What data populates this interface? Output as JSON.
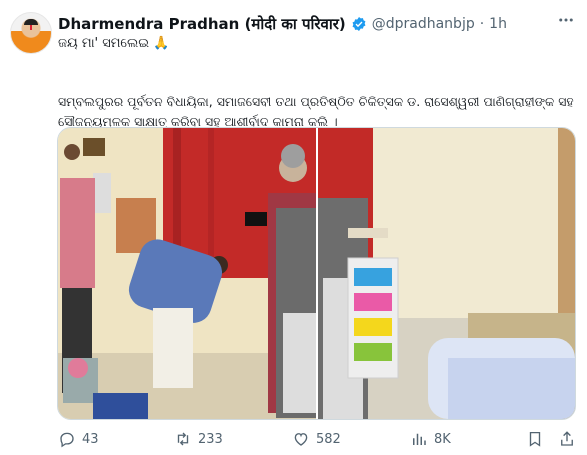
{
  "tweet": {
    "author_name": "Dharmendra Pradhan (मोदी का परिवार)",
    "handle": "@dpradhanbjp",
    "separator": "·",
    "time": "1h",
    "more_icon": "more-horizontal-icon",
    "verified_icon": "verified-badge-icon",
    "line1": "ଜୟ ମା' ସମଲେଇ 🙏",
    "para_line1": "ସମ୍ବଲପୁରର ପୂର୍ବତନ ବିଧାୟିକା, ସମାଜସେବୀ ତଥା ପ୍ରତିଷ୍ଠିତ ଚିକିତ୍ସକ ଡ. ରାସେଶ୍ୱରୀ ପାଣିଗ୍ରାହୀଙ୍କ ସହ",
    "para_line2": "ସୌଜନ୍ୟମୂଳକ ସାକ୍ଷାତ୍ କରିବା ସହ ଆଶୀର୍ବାଦ କାମନା କଲି ।"
  },
  "actions": {
    "replies": "43",
    "reposts": "233",
    "likes": "582",
    "views": "8K"
  },
  "colors": {
    "text": "#0f1419",
    "secondary": "#536471",
    "verified": "#1d9bf0",
    "border": "#cfd9de"
  }
}
